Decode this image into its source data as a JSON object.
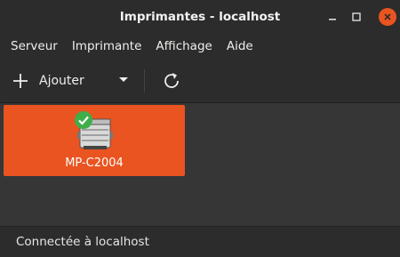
{
  "window": {
    "title": "Imprimantes - localhost",
    "accent": "#e95420"
  },
  "menubar": {
    "items": [
      "Serveur",
      "Imprimante",
      "Affichage",
      "Aide"
    ]
  },
  "toolbar": {
    "add_label": "Ajouter",
    "add_icon": "plus-icon",
    "dropdown_icon": "chevron-down-icon",
    "refresh_icon": "refresh-icon"
  },
  "printers": [
    {
      "name": "MP-C2004",
      "status_icon": "check-icon",
      "selected": true
    }
  ],
  "statusbar": {
    "text": "Connectée à localhost"
  }
}
